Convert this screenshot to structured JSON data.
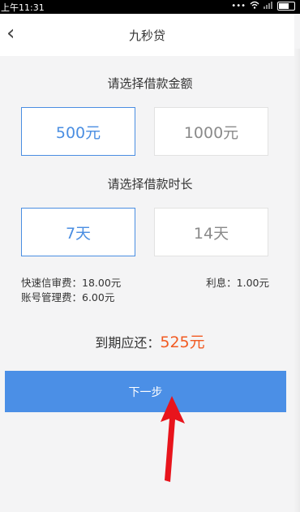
{
  "status_bar": {
    "time": "上午11:31",
    "icons": [
      "dots-icon",
      "wifi-icon",
      "signal-icon",
      "battery-icon"
    ]
  },
  "nav": {
    "back_icon": "‹",
    "title": "九秒贷"
  },
  "amount": {
    "label": "请选择借款金额",
    "options": [
      {
        "label": "500元",
        "selected": true
      },
      {
        "label": "1000元",
        "selected": false
      }
    ]
  },
  "duration": {
    "label": "请选择借款时长",
    "options": [
      {
        "label": "7天",
        "selected": true
      },
      {
        "label": "14天",
        "selected": false
      }
    ]
  },
  "fees": {
    "review_fee": "快速信审费：18.00元",
    "account_fee": "账号管理费：6.00元",
    "interest": "利息：1.00元"
  },
  "repay": {
    "label": "到期应还：",
    "amount": "525元"
  },
  "next_button": {
    "label": "下一步"
  },
  "colors": {
    "accent": "#4b8fe6",
    "highlight": "#f15a22",
    "arrow": "#e8141c"
  }
}
